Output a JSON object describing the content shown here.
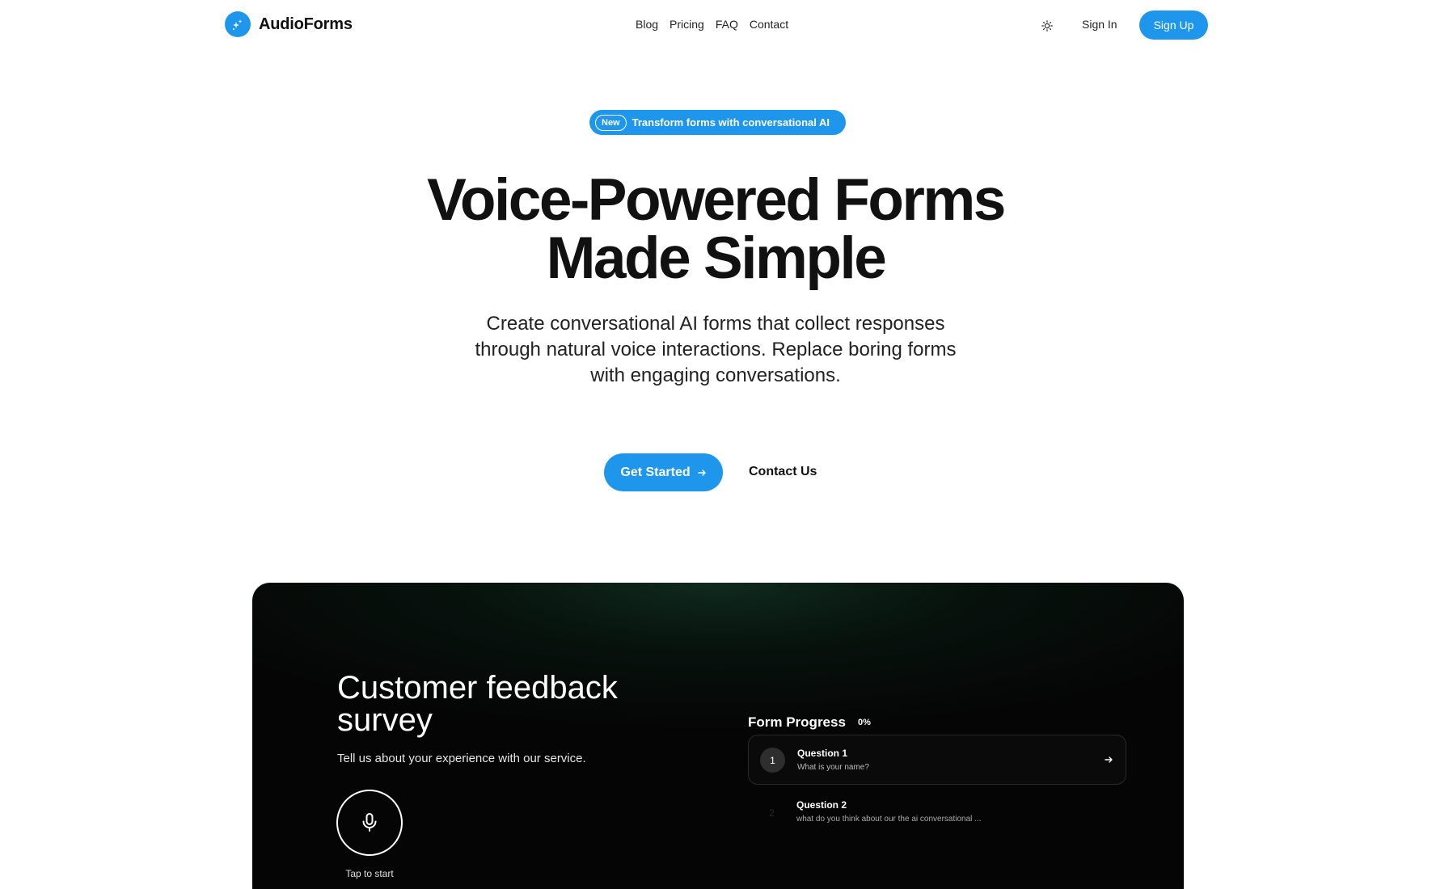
{
  "header": {
    "brand_name": "AudioForms",
    "brand_icon": "sparkles-icon",
    "nav": [
      "Blog",
      "Pricing",
      "FAQ",
      "Contact"
    ],
    "theme_icon": "sun-icon",
    "sign_in": "Sign In",
    "sign_up": "Sign Up"
  },
  "hero": {
    "badge_tag": "New",
    "badge_text": "Transform forms with conversational AI",
    "title_line1": "Voice-Powered Forms",
    "title_line2": "Made Simple",
    "subtitle": "Create conversational AI forms that collect responses through natural voice interactions. Replace boring forms with engaging conversations.",
    "cta_primary": "Get Started",
    "cta_secondary": "Contact Us"
  },
  "demo": {
    "survey_title": "Customer feedback survey",
    "survey_description": "Tell us about your experience with our service.",
    "mic_icon": "microphone-icon",
    "mic_label": "Tap to start",
    "progress_title": "Form Progress",
    "progress_value": "0%",
    "questions": [
      {
        "number": "1",
        "title": "Question 1",
        "text": "What is your name?"
      },
      {
        "number": "2",
        "title": "Question 2",
        "text": "what do you think about our the ai conversational ..."
      }
    ]
  },
  "colors": {
    "accent": "#1e96ec",
    "panel_bg": "#050505",
    "text": "#111111"
  }
}
